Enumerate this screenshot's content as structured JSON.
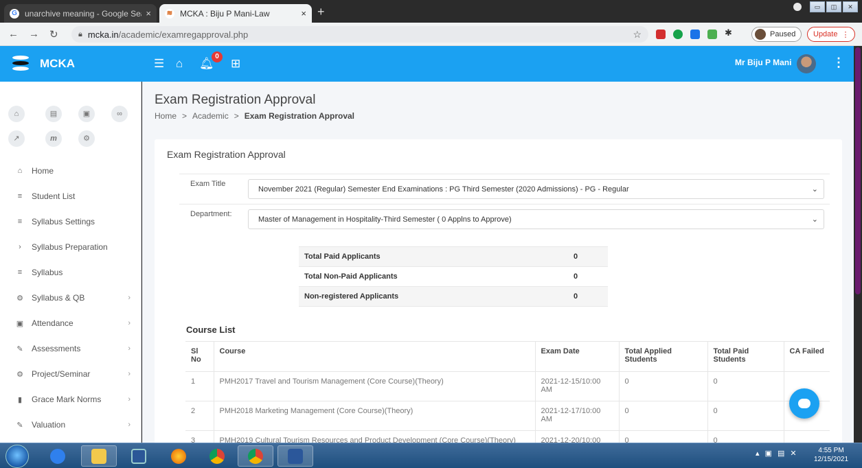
{
  "browser": {
    "tabs": [
      {
        "title": "unarchive meaning - Google Sea",
        "close": "×"
      },
      {
        "title": "MCKA : Biju P Mani-Law",
        "close": "×"
      }
    ],
    "new_tab": "+",
    "url_host": "mcka.in",
    "url_path": "/academic/examregapproval.php",
    "profile_status": "Paused",
    "update_label": "Update",
    "update_menu": "⋮"
  },
  "app": {
    "name": "MCKA",
    "notification_count": "0",
    "user_name": "Mr Biju P Mani"
  },
  "sidebar": {
    "items": [
      {
        "label": "Home",
        "icon": "home-icon",
        "glyph": "⌂",
        "chevron": false
      },
      {
        "label": "Student List",
        "icon": "list-icon",
        "glyph": "≡",
        "chevron": false
      },
      {
        "label": "Syllabus Settings",
        "icon": "list-icon",
        "glyph": "≡",
        "chevron": false
      },
      {
        "label": "Syllabus Preparation",
        "icon": "chevron-right-icon",
        "glyph": "›",
        "chevron": false
      },
      {
        "label": "Syllabus",
        "icon": "list-icon",
        "glyph": "≡",
        "chevron": false
      },
      {
        "label": "Syllabus & QB",
        "icon": "gears-icon",
        "glyph": "⚙",
        "chevron": true
      },
      {
        "label": "Attendance",
        "icon": "calendar-icon",
        "glyph": "▣",
        "chevron": true
      },
      {
        "label": "Assessments",
        "icon": "pencil-icon",
        "glyph": "✎",
        "chevron": true
      },
      {
        "label": "Project/Seminar",
        "icon": "gears-icon",
        "glyph": "⚙",
        "chevron": true
      },
      {
        "label": "Grace Mark Norms",
        "icon": "book-icon",
        "glyph": "▮",
        "chevron": true
      },
      {
        "label": "Valuation",
        "icon": "pencil-icon",
        "glyph": "✎",
        "chevron": true
      }
    ],
    "chevron": "›"
  },
  "page": {
    "title": "Exam Registration Approval",
    "breadcrumb": [
      "Home",
      "Academic",
      "Exam Registration Approval"
    ],
    "breadcrumb_sep": ">",
    "card_title": "Exam Registration Approval",
    "exam_title_label": "Exam Title",
    "exam_title_value": "November 2021 (Regular) Semester End Examinations : PG Third Semester (2020 Admissions) - PG - Regular",
    "department_label": "Department:",
    "department_value": "Master of Management in Hospitality-Third Semester ( 0 Applns to Approve)",
    "stats": [
      {
        "label": "Total Paid Applicants",
        "value": "0"
      },
      {
        "label": "Total Non-Paid Applicants",
        "value": "0"
      },
      {
        "label": "Non-registered Applicants",
        "value": "0"
      }
    ],
    "course_list_title": "Course List",
    "columns": [
      "Sl No",
      "Course",
      "Exam Date",
      "Total Applied Students",
      "Total Paid Students",
      "CA Failed"
    ],
    "rows": [
      {
        "sl": "1",
        "course": "PMH2017 Travel and Tourism Management (Core Course)(Theory)",
        "date": "2021-12-15/10:00 AM",
        "applied": "0",
        "paid": "0",
        "ca": ""
      },
      {
        "sl": "2",
        "course": "PMH2018 Marketing Management (Core Course)(Theory)",
        "date": "2021-12-17/10:00 AM",
        "applied": "0",
        "paid": "0",
        "ca": ""
      },
      {
        "sl": "3",
        "course": "PMH2019 Cultural Tourism Resources and Product Development (Core Course)(Theory)",
        "date": "2021-12-20/10:00",
        "applied": "0",
        "paid": "0",
        "ca": ""
      }
    ]
  },
  "taskbar": {
    "time": "4:55 PM",
    "date": "12/15/2021"
  }
}
